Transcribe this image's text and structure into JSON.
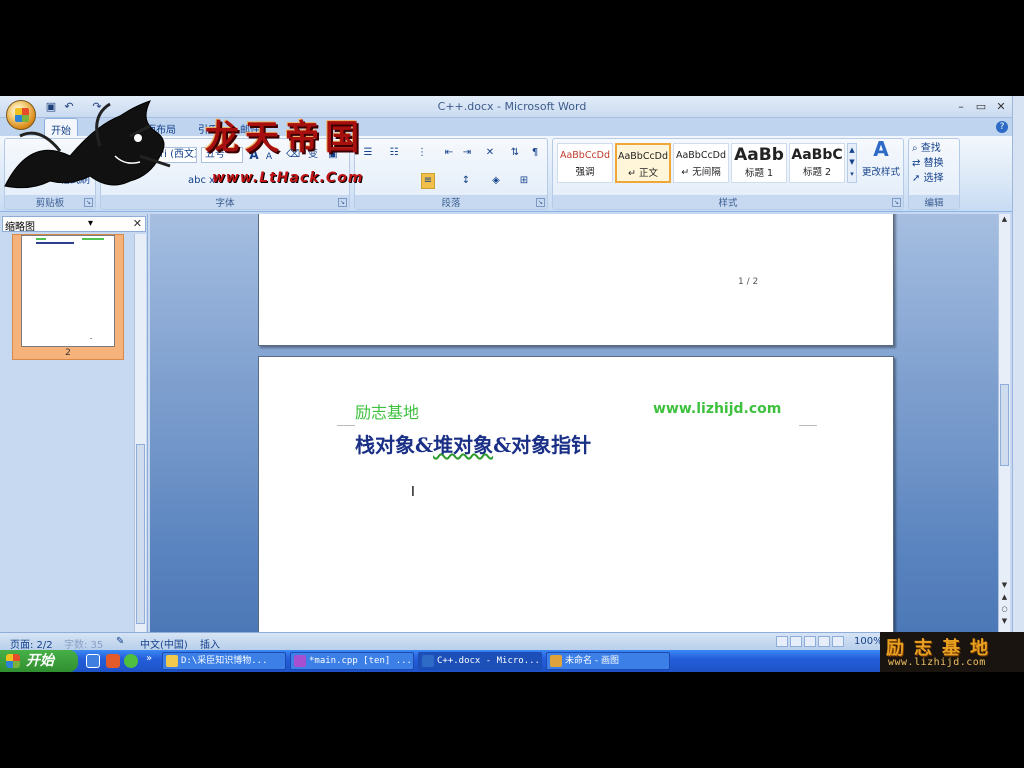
{
  "window": {
    "title": "C++.docx - Microsoft Word"
  },
  "ribbon_tabs": [
    "开始",
    "页面布局",
    "引用",
    "邮件"
  ],
  "clipboard_group": {
    "label": "剪贴板",
    "format_painter": "格式刷"
  },
  "font_group": {
    "label": "字体",
    "font_name": "Calibri (西文正文)",
    "font_size": "五号",
    "grow": "A",
    "shrink": "A"
  },
  "paragraph_group": {
    "label": "段落"
  },
  "styles_group": {
    "label": "样式",
    "tiles": [
      {
        "sample": "AaBbCcDd",
        "name": "强调",
        "color": "#c0392b"
      },
      {
        "sample": "AaBbCcDd",
        "name": "↵ 正文",
        "color": "#222222"
      },
      {
        "sample": "AaBbCcDd",
        "name": "↵ 无间隔",
        "color": "#222222"
      },
      {
        "sample": "AaBb",
        "name": "标题 1",
        "color": "#111111"
      },
      {
        "sample": "AaBbC",
        "name": "标题 2",
        "color": "#111111"
      }
    ],
    "change_styles": "更改样式"
  },
  "editing_group": {
    "label": "编辑",
    "find": "查找",
    "replace": "替换",
    "select": "选择"
  },
  "overlay_logo": {
    "title": "龙天帝国",
    "url": "www.LtHack.Com"
  },
  "thumbnail_pane": {
    "select_label": "缩略图",
    "page_number": "2"
  },
  "document": {
    "page_indicator": "1 / 2",
    "header_left": "励志基地",
    "header_right": "www.lizhijd.com",
    "heading_part1": "栈对象&",
    "heading_part2": "堆对象",
    "heading_part3": "&对象指针"
  },
  "status_bar": {
    "page": "页面: 2/2",
    "words": "字数: 35",
    "language": "中文(中国)",
    "mode": "插入",
    "zoom": "100%"
  },
  "taskbar": {
    "start": "开始",
    "tasks": [
      {
        "label": "D:\\采臣知识博物...",
        "icon_color": "#f2c94c"
      },
      {
        "label": "*main.cpp [ten] ...",
        "icon_color": "#a64fd0"
      },
      {
        "label": "C++.docx - Micro...",
        "icon_color": "#2d6bc6"
      },
      {
        "label": "未命名 - 画图",
        "icon_color": "#e0a23a"
      }
    ]
  },
  "watermark": {
    "title": "励志基地",
    "url": "www.lizhijd.com"
  }
}
